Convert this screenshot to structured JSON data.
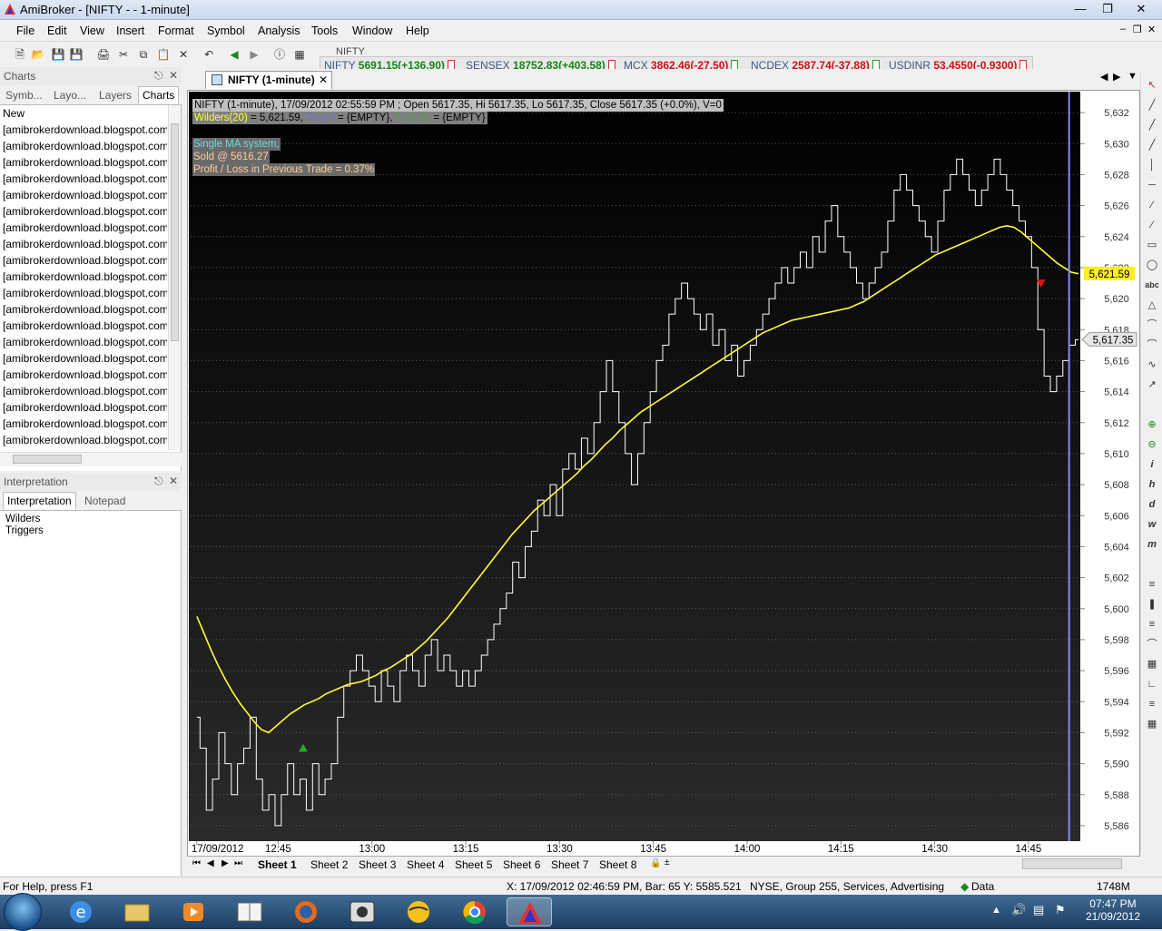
{
  "window": {
    "title": "AmiBroker - [NIFTY -  - 1-minute]"
  },
  "menu": [
    "File",
    "Edit",
    "View",
    "Insert",
    "Format",
    "Symbol",
    "Analysis",
    "Tools",
    "Window",
    "Help"
  ],
  "toolbar": {
    "symbol_box": "NIFTY"
  },
  "ticker": [
    {
      "name": "NIFTY",
      "value": "5691.15(+136.90)",
      "dir": "up"
    },
    {
      "name": "SENSEX",
      "value": "18752.83(+403.58)",
      "dir": "up"
    },
    {
      "name": "MCX",
      "value": "3862.46(-27.50)",
      "dir": "dn"
    },
    {
      "name": "NCDEX",
      "value": "2587.74(-37.88)",
      "dir": "dn"
    },
    {
      "name": "USDINR",
      "value": "53.4550(-0.9300)",
      "dir": "dn"
    }
  ],
  "charts_panel": {
    "title": "Charts",
    "tabs": [
      "Symb...",
      "Layo...",
      "Layers",
      "Charts"
    ],
    "items": [
      "New",
      "[amibrokerdownload.blogspot.com]",
      "[amibrokerdownload.blogspot.com]",
      "[amibrokerdownload.blogspot.com]",
      "[amibrokerdownload.blogspot.com]",
      "[amibrokerdownload.blogspot.com]",
      "[amibrokerdownload.blogspot.com]",
      "[amibrokerdownload.blogspot.com]",
      "[amibrokerdownload.blogspot.com]",
      "[amibrokerdownload.blogspot.com]",
      "[amibrokerdownload.blogspot.com]",
      "[amibrokerdownload.blogspot.com]",
      "[amibrokerdownload.blogspot.com]",
      "[amibrokerdownload.blogspot.com]",
      "[amibrokerdownload.blogspot.com]",
      "[amibrokerdownload.blogspot.com]",
      "[amibrokerdownload.blogspot.com]",
      "[amibrokerdownload.blogspot.com]",
      "[amibrokerdownload.blogspot.com]",
      "[amibrokerdownload.blogspot.com]",
      "[amibrokerdownload.blogspot.com]"
    ]
  },
  "interp_panel": {
    "title": "Interpretation",
    "tabs": [
      "Interpretation",
      "Notepad"
    ],
    "lines": [
      "Wilders",
      "Triggers"
    ]
  },
  "doc_tab": "NIFTY (1-minute)",
  "chart_header": {
    "line1": "NIFTY (1-minute), 17/09/2012 02:55:59 PM ; Open 5617.35, Hi 5617.35, Lo 5617.35, Close 5617.35 (+0.0%), V=0",
    "wilders_label": "Wilders(20)",
    "wilders_value": " = 5,621.59, ",
    "target_label": "Target",
    "target_value": " = {EMPTY}, ",
    "trail_label": "Trail SL",
    "trail_value": " = {EMPTY}",
    "system": "Single MA system,",
    "sold": "Sold @ 5616.27",
    "pl": "Profit / Loss in Previous Trade = 0.37%"
  },
  "chart_data": {
    "type": "line",
    "symbol": "NIFTY",
    "interval": "1-minute",
    "ylim": [
      5585,
      5633
    ],
    "y_ticks": [
      5586,
      5588,
      5590,
      5592,
      5594,
      5596,
      5598,
      5600,
      5602,
      5604,
      5606,
      5608,
      5610,
      5612,
      5614,
      5616,
      5618,
      5620,
      5622,
      5624,
      5626,
      5628,
      5630,
      5632
    ],
    "x_ticks": [
      {
        "label": "17/09/2012",
        "t": 0
      },
      {
        "label": "12:45",
        "t": 13
      },
      {
        "label": "13:00",
        "t": 28
      },
      {
        "label": "13:15",
        "t": 43
      },
      {
        "label": "13:30",
        "t": 58
      },
      {
        "label": "13:45",
        "t": 73
      },
      {
        "label": "14:00",
        "t": 88
      },
      {
        "label": "14:15",
        "t": 103
      },
      {
        "label": "14:30",
        "t": 118
      },
      {
        "label": "14:45",
        "t": 133
      }
    ],
    "t_range": [
      -1,
      141
    ],
    "price": [
      5593,
      5591,
      5587,
      5589,
      5592,
      5590,
      5588,
      5590,
      5591,
      5593,
      5589,
      5587,
      5588,
      5586,
      5588,
      5590,
      5588,
      5589,
      5587,
      5590,
      5588,
      5589,
      5590,
      5593,
      5595,
      5596,
      5597,
      5596,
      5595,
      5594,
      5596,
      5595,
      5594,
      5596,
      5597,
      5596,
      5595,
      5597,
      5598,
      5596,
      5597,
      5596,
      5595,
      5596,
      5595,
      5596,
      5597,
      5598,
      5599,
      5600,
      5601,
      5603,
      5602,
      5604,
      5605,
      5607,
      5606,
      5608,
      5606,
      5609,
      5610,
      5609,
      5611,
      5610,
      5612,
      5614,
      5616,
      5614,
      5612,
      5610,
      5608,
      5610,
      5612,
      5614,
      5616,
      5617,
      5619,
      5620,
      5621,
      5620,
      5619,
      5618,
      5619,
      5617,
      5618,
      5616,
      5617,
      5615,
      5616,
      5617,
      5618,
      5619,
      5620,
      5621,
      5622,
      5621,
      5622,
      5623,
      5622,
      5624,
      5623,
      5625,
      5626,
      5624,
      5623,
      5622,
      5621,
      5620,
      5621,
      5622,
      5623,
      5625,
      5627,
      5628,
      5627,
      5626,
      5625,
      5624,
      5623,
      5625,
      5627,
      5628,
      5629,
      5628,
      5627,
      5626,
      5627,
      5628,
      5629,
      5628,
      5627,
      5626,
      5625,
      5624,
      5622,
      5618,
      5615,
      5614,
      5615,
      5616,
      5617,
      5617.35
    ],
    "series": [
      {
        "name": "Wilders(20)",
        "color": "#ffff33",
        "values": [
          5599.5,
          5598.4,
          5597.3,
          5596.3,
          5595.4,
          5594.6,
          5593.9,
          5593.3,
          5592.7,
          5592.2,
          5592.0,
          5592.4,
          5592.8,
          5593.2,
          5593.5,
          5593.8,
          5594.0,
          5594.2,
          5594.5,
          5594.7,
          5594.9,
          5595.1,
          5595.2,
          5595.3,
          5595.5,
          5595.7,
          5596.0,
          5596.2,
          5596.5,
          5596.8,
          5597.1,
          5597.5,
          5597.9,
          5598.4,
          5598.9,
          5599.4,
          5600.0,
          5600.6,
          5601.2,
          5601.8,
          5602.4,
          5603.0,
          5603.6,
          5604.2,
          5604.8,
          5605.3,
          5605.8,
          5606.3,
          5606.7,
          5607.1,
          5607.5,
          5607.9,
          5608.3,
          5608.7,
          5609.2,
          5609.6,
          5610.1,
          5610.6,
          5611.0,
          5611.5,
          5611.9,
          5612.3,
          5612.7,
          5613.0,
          5613.3,
          5613.6,
          5613.9,
          5614.2,
          5614.5,
          5614.8,
          5615.1,
          5615.4,
          5615.7,
          5616.0,
          5616.3,
          5616.6,
          5616.9,
          5617.2,
          5617.5,
          5617.8,
          5618.0,
          5618.2,
          5618.4,
          5618.6,
          5618.7,
          5618.8,
          5618.9,
          5619.0,
          5619.1,
          5619.2,
          5619.3,
          5619.4,
          5619.6,
          5619.8,
          5620.1,
          5620.4,
          5620.7,
          5621.0,
          5621.3,
          5621.6,
          5621.9,
          5622.2,
          5622.5,
          5622.8,
          5623.0,
          5623.2,
          5623.4,
          5623.6,
          5623.8,
          5624.0,
          5624.2,
          5624.4,
          5624.6,
          5624.7,
          5624.6,
          5624.3,
          5623.9,
          5623.5,
          5623.1,
          5622.7,
          5622.3,
          5622.0,
          5621.7,
          5621.6
        ]
      }
    ],
    "wilders_t_start": 0,
    "wilders_plot_t": [
      0,
      2,
      4,
      6,
      8,
      10,
      12,
      14,
      16,
      18,
      20,
      22,
      24,
      26,
      28,
      30,
      32,
      34,
      36,
      38,
      40,
      42,
      44,
      46,
      48,
      50,
      52,
      54,
      56,
      58,
      60,
      62,
      64,
      66,
      68,
      70,
      72,
      74,
      76,
      78,
      80,
      82,
      84,
      86,
      88,
      90,
      92,
      94,
      96,
      98,
      100,
      102,
      104,
      106,
      108,
      110,
      112,
      114,
      116,
      118,
      120,
      122,
      124,
      126,
      128,
      130,
      132,
      134,
      136,
      138,
      140
    ],
    "buy_signal": {
      "t": 17,
      "price": 5591
    },
    "sell_signal": {
      "t": 135,
      "price": 5621
    },
    "wilders_last": "5,621.59",
    "close_last": "5,617.35",
    "cursor_t": 139.5,
    "background": "#000000",
    "wilders_color": "#ffff33",
    "price_color": "#ffffff",
    "buy_color": "#22aa22",
    "sell_color": "#dd1111",
    "cursor_color": "#8888ff"
  },
  "sheets": [
    "Sheet 1",
    "Sheet 2",
    "Sheet 3",
    "Sheet 4",
    "Sheet 5",
    "Sheet 6",
    "Sheet 7",
    "Sheet 8"
  ],
  "status": {
    "help": "For Help, press F1",
    "cursor": "X: 17/09/2012 02:46:59 PM, Bar: 65  Y: 5585.521",
    "exchange": "NYSE, Group 255, Services, Advertising",
    "data": "Data",
    "memory": "1748M"
  },
  "clock": {
    "time": "07:47 PM",
    "date": "21/09/2012"
  }
}
